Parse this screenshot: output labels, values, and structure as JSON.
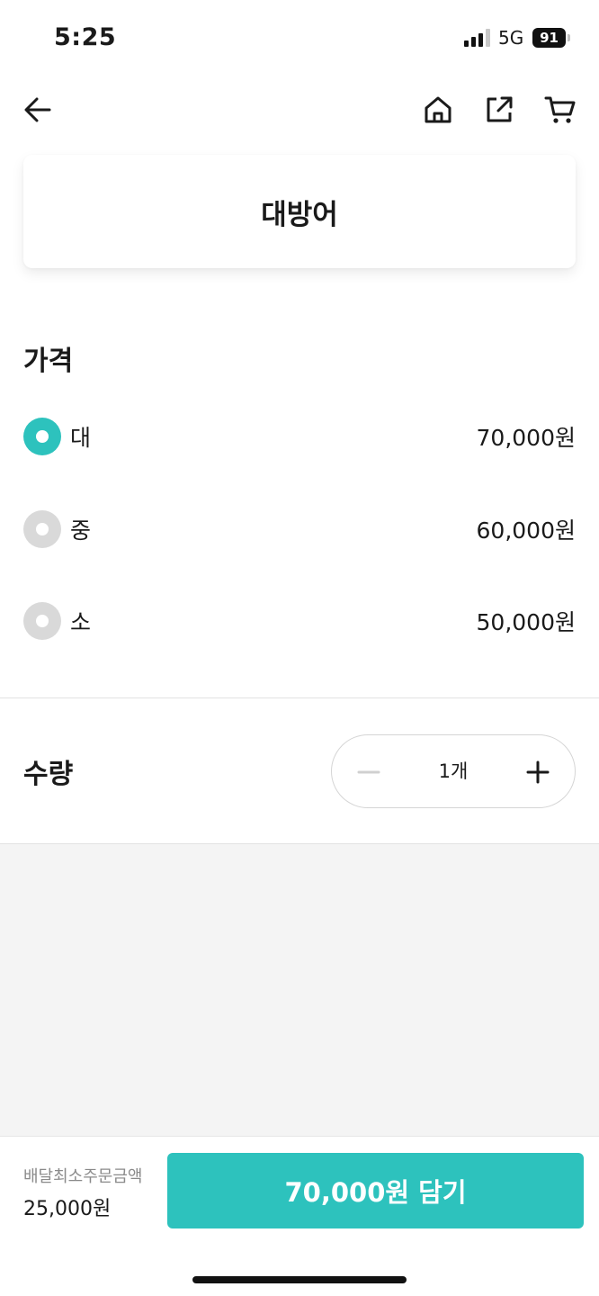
{
  "status_bar": {
    "time": "5:25",
    "network": "5G",
    "battery": "91"
  },
  "nav": {
    "back_icon": "arrow-left-icon",
    "home_icon": "home-icon",
    "share_icon": "share-icon",
    "cart_icon": "cart-icon"
  },
  "product": {
    "title": "대방어"
  },
  "price_section": {
    "title": "가격",
    "options": [
      {
        "label": "대",
        "price": "70,000원",
        "selected": true
      },
      {
        "label": "중",
        "price": "60,000원",
        "selected": false
      },
      {
        "label": "소",
        "price": "50,000원",
        "selected": false
      }
    ]
  },
  "quantity": {
    "title": "수량",
    "value": "1개"
  },
  "bottom_bar": {
    "min_order_label": "배달최소주문금액",
    "min_order_value": "25,000원",
    "add_button_label": "70,000원 담기"
  },
  "colors": {
    "accent": "#2dc2bd",
    "radio_unselected": "#d9d9d9",
    "background_gray": "#f4f4f4"
  }
}
